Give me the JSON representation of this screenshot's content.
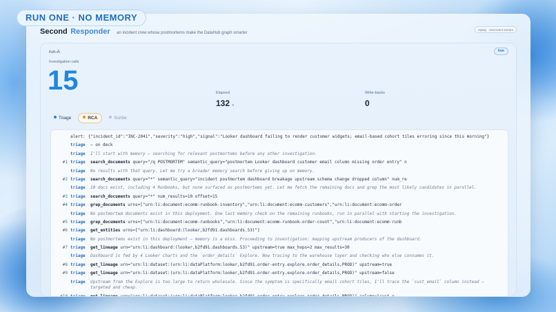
{
  "badge": "RUN ONE · NO MEMORY",
  "header": {
    "brand_first": "Second",
    "brand_second": "Responder",
    "tagline": "an incident crew whose postmortems make the DataHub graph smarter",
    "replay_pill": "replay · real event stream"
  },
  "panel": {
    "run_label": "run-A",
    "live": "live",
    "stats": {
      "calls_label": "Investigation calls",
      "calls_value": "15",
      "elapsed_label": "Elapsed",
      "elapsed_value": "132",
      "elapsed_unit": "s",
      "writebacks_label": "Write-backs",
      "writebacks_value": "0"
    },
    "tabs": [
      {
        "label": "Triage",
        "color": "#2b7fd4"
      },
      {
        "label": "RCA",
        "color": "#e0902b"
      },
      {
        "label": "Scribe",
        "color": "#b8c2ce"
      }
    ]
  },
  "log": [
    {
      "num": "",
      "role": "",
      "alert": "alert:",
      "text": "{\"incident_id\":\"INC-2041\",\"severity\":\"high\",\"signal\":\"Looker dashboard failing to render customer widgets; email-based cohort tiles erroring since this morning\"}",
      "italic": false
    },
    {
      "num": "",
      "role": "triage",
      "text": "— on deck",
      "italic": false
    },
    {
      "num": "",
      "role": "triage",
      "text": "I'll start with memory — searching for relevant postmortems before any other investigation.",
      "italic": true
    },
    {
      "num": "#1",
      "role": "triage",
      "tool": "search_documents",
      "text": " query=\"/q POSTMORTEM\" semantic_query=\"postmortem Looker dashboard customer email column missing order entry\" n",
      "italic": false
    },
    {
      "num": "",
      "role": "triage",
      "text": "No results with that query. Let me try a broader memory search before giving up on memory.",
      "italic": true
    },
    {
      "num": "#2",
      "role": "triage",
      "tool": "search_documents",
      "text": " query=\"*\" semantic_query=\"incident postmortem dashboard breakage upstream schema change dropped column\" num_re",
      "italic": false
    },
    {
      "num": "",
      "role": "triage",
      "text": "10 docs exist, including 4 Runbooks, but none surfaced as postmortems yet. Let me fetch the remaining docs and grep the most likely candidates in parallel.",
      "italic": true
    },
    {
      "num": "#3",
      "role": "triage",
      "tool": "search_documents",
      "text": " query=\"*\" num_results=10 offset=15",
      "italic": false
    },
    {
      "num": "#4",
      "role": "triage",
      "tool": "grep_documents",
      "text": " urns=[\"urn:li:document:ecomm-runbook-inventory\",\"urn:li:document:ecomm-customers\",\"urn:li:document:ecomm-order",
      "italic": false
    },
    {
      "num": "",
      "role": "triage",
      "text": "No postmortem documents exist in this deployment. One last memory check on the remaining runbooks, run in parallel with starting the investigation.",
      "italic": true
    },
    {
      "num": "#5",
      "role": "triage",
      "tool": "grep_documents",
      "text": " urns=[\"urn:li:document:ecomm-runbooks\",\"urn:li:document:ecomm-runbook-order-count\",\"urn:li:document:ecomm-runb",
      "italic": false
    },
    {
      "num": "#6",
      "role": "triage",
      "tool": "get_entities",
      "text": " urns=[\"urn:li:dashboard:(looker,b2fd91.dashboards.53)\"]",
      "italic": false
    },
    {
      "num": "",
      "role": "triage",
      "text": "No postmortems exist in this deployment — memory is a miss. Proceeding to investigation: mapping upstream producers of the dashboard.",
      "italic": true
    },
    {
      "num": "#7",
      "role": "triage",
      "tool": "get_lineage",
      "text": " urn=\"urn:li:dashboard:(looker,b2fd91.dashboards.53)\" upstream=true max_hops=2 max_results=30",
      "italic": false
    },
    {
      "num": "",
      "role": "triage",
      "text": "Dashboard is fed by 4 Looker charts and the `order_details` Explore. Now tracing to the warehouse layer and checking who else consumes it.",
      "italic": true
    },
    {
      "num": "#8",
      "role": "triage",
      "tool": "get_lineage",
      "text": " urn=\"urn:li:dataset:(urn:li:dataPlatform:looker,b2fd91.order-entry.explore.order_details,PROD)\" upstream=true",
      "italic": false
    },
    {
      "num": "#9",
      "role": "triage",
      "tool": "get_lineage",
      "text": " urn=\"urn:li:dataset:(urn:li:dataPlatform:looker,b2fd91.order-entry.explore.order_details,PROD)\" upstream=false",
      "italic": false
    },
    {
      "num": "",
      "role": "triage",
      "text": "Upstream from the Explore is too large to return wholesale. Since the symptom is specifically email cohort tiles, I'll trace the `cust_email` column instead — targeted and cheap.",
      "italic": true
    },
    {
      "num": "#10",
      "role": "triage",
      "tool": "get_lineage",
      "text": " urn=\"urn:li:dataset:(urn:li:dataPlatform:looker,b2fd91.order-entry.explore.order_details,PROD)\" column=\"cust_e",
      "italic": false
    }
  ]
}
